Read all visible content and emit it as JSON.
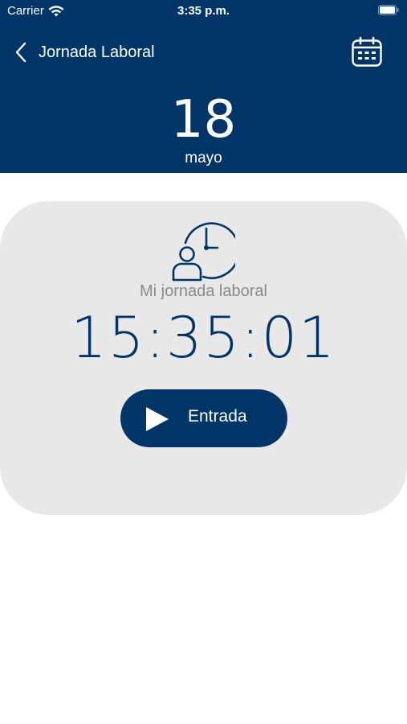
{
  "status_bar": {
    "carrier": "Carrier",
    "time": "3:35 p.m."
  },
  "navbar": {
    "title": "Jornada Laboral"
  },
  "date": {
    "day": "18",
    "month": "mayo"
  },
  "card": {
    "label": "Mi jornada laboral",
    "clock": "15:35:01",
    "button_label": "Entrada"
  },
  "colors": {
    "primary": "#013567",
    "card_bg": "#e8e8e8",
    "label_gray": "#8a8a8a"
  },
  "icons": {
    "back": "chevron-left-icon",
    "calendar": "calendar-icon",
    "worker": "worker-clock-icon",
    "play": "play-icon",
    "wifi": "wifi-icon",
    "battery": "battery-icon"
  }
}
